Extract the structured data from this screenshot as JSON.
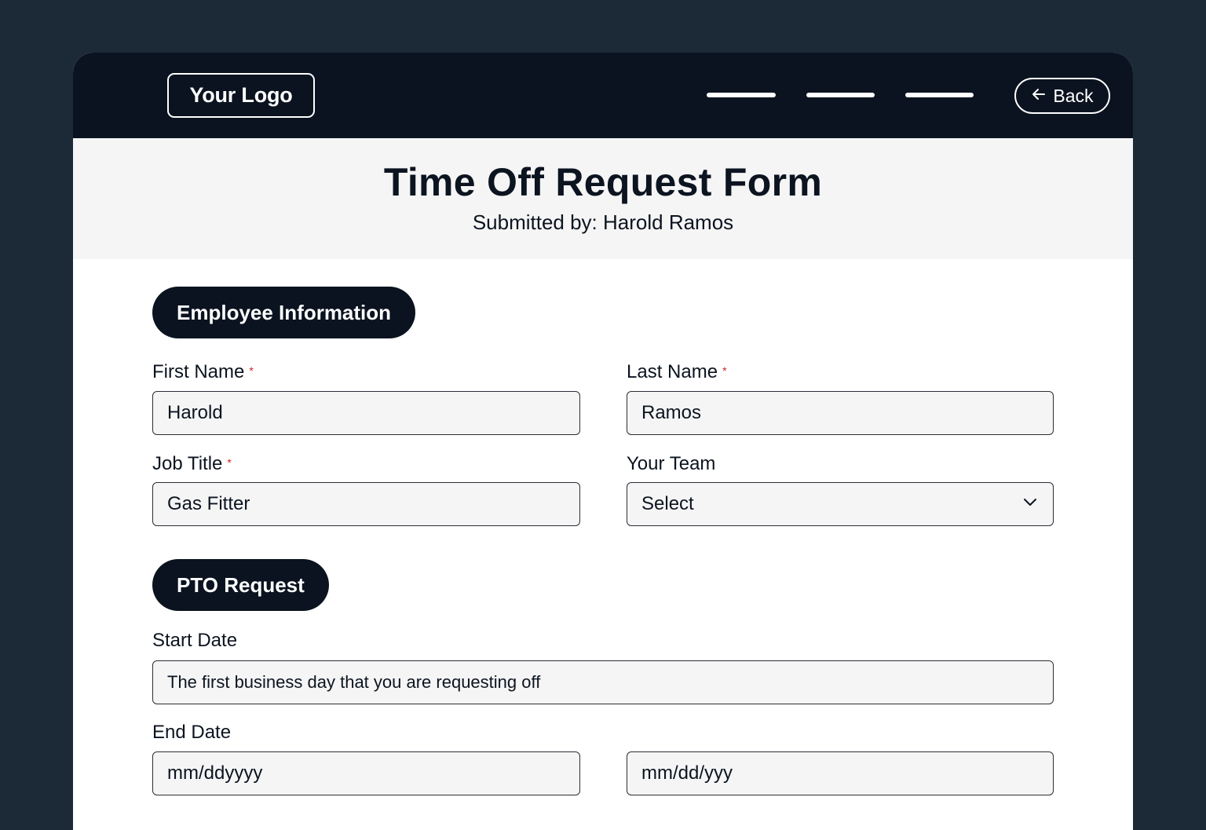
{
  "header": {
    "logo": "Your Logo",
    "back_label": "Back"
  },
  "page": {
    "title": "Time Off Request Form",
    "subtitle": "Submitted by: Harold Ramos"
  },
  "sections": {
    "employee": "Employee Information",
    "pto": "PTO Request"
  },
  "fields": {
    "first_name": {
      "label": "First Name",
      "value": "Harold",
      "required": "*"
    },
    "last_name": {
      "label": "Last Name",
      "value": "Ramos",
      "required": "*"
    },
    "job_title": {
      "label": "Job Title",
      "value": "Gas Fitter",
      "required": "*"
    },
    "team": {
      "label": "Your Team",
      "value": "Select"
    },
    "start_date": {
      "label": "Start Date",
      "value": "The first business day that you are requesting off"
    },
    "end_date": {
      "label": "End Date",
      "value_left": "mm/ddyyyy",
      "value_right": "mm/dd/yyy"
    }
  },
  "colors": {
    "background": "#1c2a38",
    "topbar": "#0b1320",
    "header_band": "#f5f5f5",
    "field_fill": "#f5f5f5",
    "required_mark": "#d12020"
  },
  "icons": {
    "back": "arrow-left-icon",
    "select": "chevron-down-icon"
  }
}
